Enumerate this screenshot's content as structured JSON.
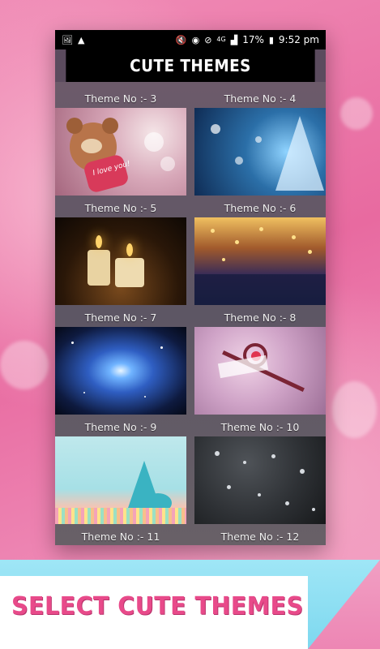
{
  "status_bar": {
    "time": "9:52 pm",
    "battery": "17%",
    "network": "4G",
    "left_icons": [
      "image-icon",
      "warning-icon"
    ],
    "right_icons": [
      "mute-icon",
      "circle-icon",
      "block-icon",
      "signal-icon",
      "battery-icon"
    ]
  },
  "app_bar": {
    "title": "CUTE THEMES"
  },
  "themes": [
    {
      "label": "Theme No :- 3"
    },
    {
      "label": "Theme No :- 4"
    },
    {
      "label": "Theme No :- 5"
    },
    {
      "label": "Theme No :- 6"
    },
    {
      "label": "Theme No :- 7"
    },
    {
      "label": "Theme No :- 8"
    },
    {
      "label": "Theme No :- 9"
    },
    {
      "label": "Theme No :- 10"
    },
    {
      "label": "Theme No :- 11"
    },
    {
      "label": "Theme No :- 12"
    }
  ],
  "thumb_texts": {
    "bear_heart": "I love you!"
  },
  "banner": {
    "text": "SELECT CUTE THEMES"
  },
  "colors": {
    "banner_text": "#e84a8a",
    "background_pink": "#e86aa0",
    "banner_cyan": "#7dd8ef"
  }
}
